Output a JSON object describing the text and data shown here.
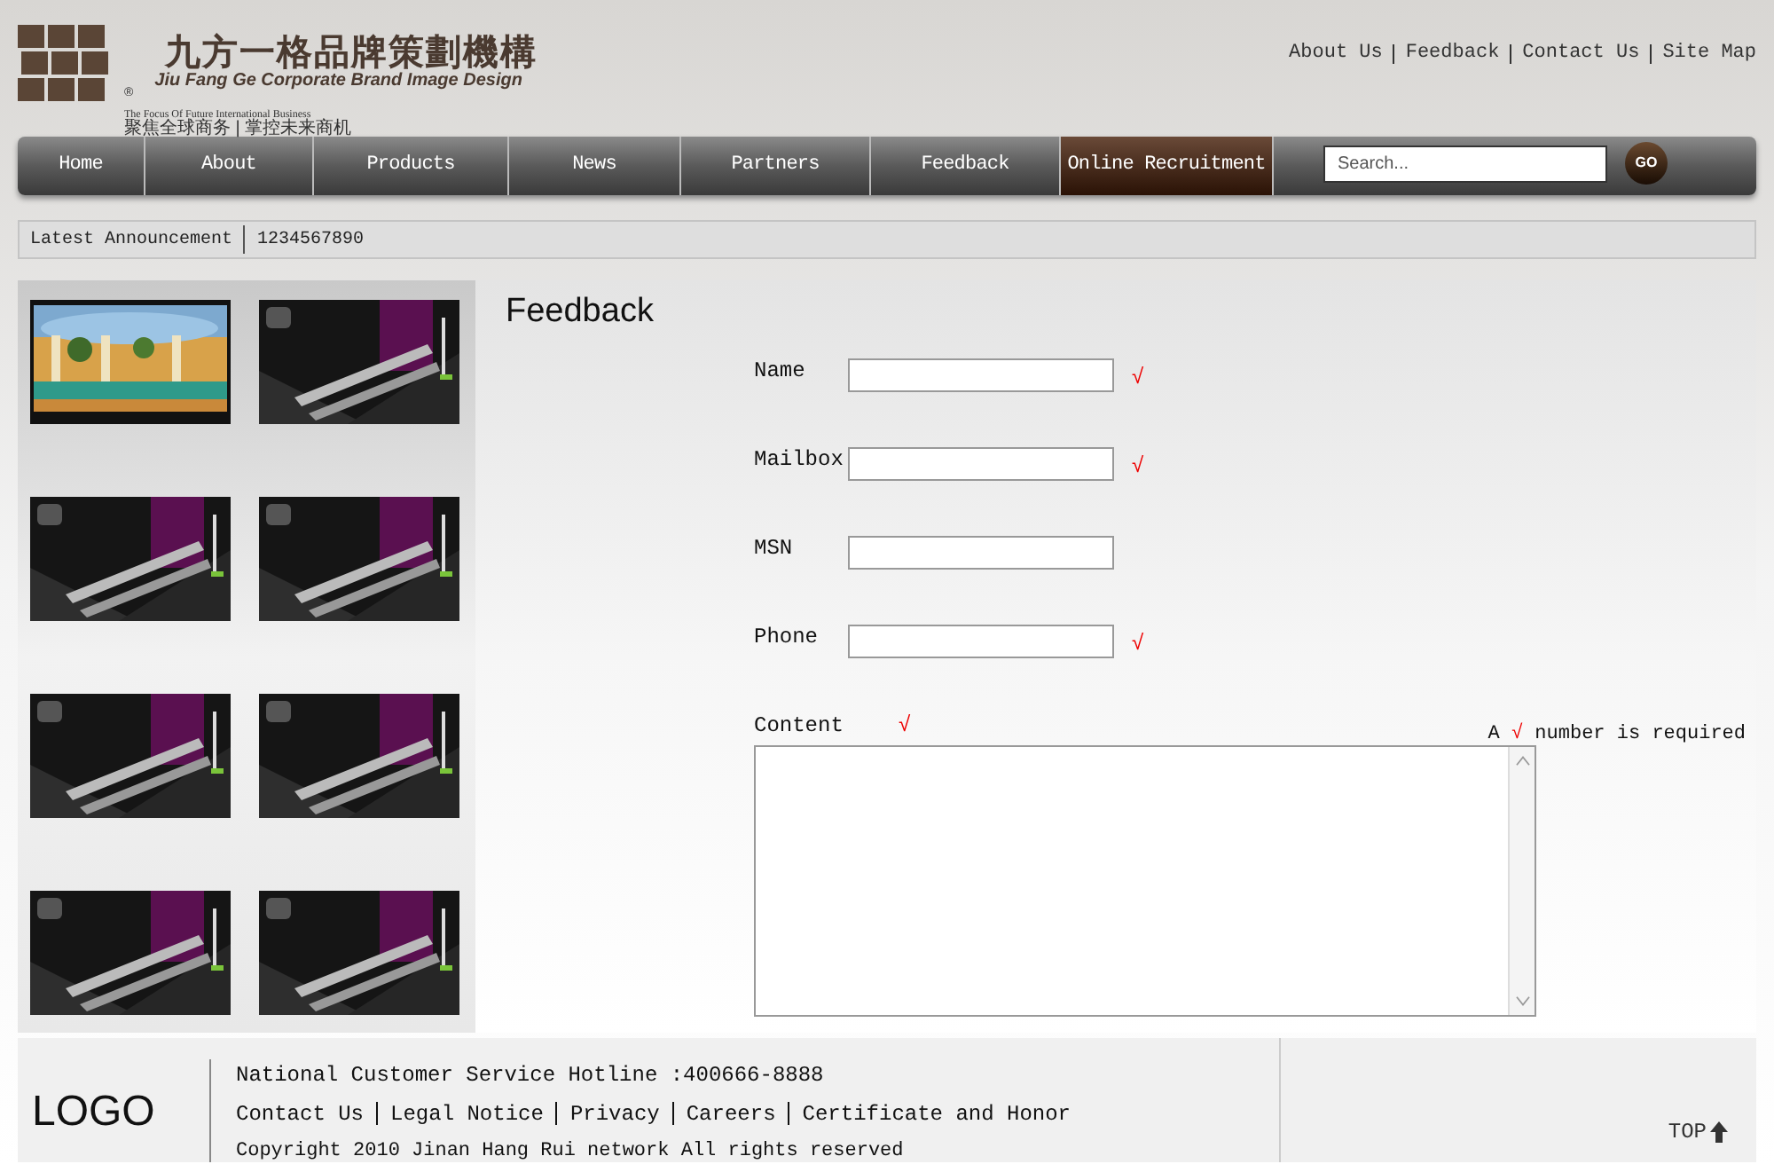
{
  "logo": {
    "title": "九方一格品牌策劃機構",
    "subtitle": "Jiu Fang Ge Corporate Brand Image Design",
    "mark": "®",
    "tagline": "The Focus Of Future International Business",
    "tagline_cn": "聚焦全球商务 | 掌控未来商机"
  },
  "top_links": [
    "About Us",
    "Feedback",
    "Contact Us",
    "Site Map"
  ],
  "nav": [
    {
      "label": "Home",
      "selected": false
    },
    {
      "label": "About",
      "selected": false
    },
    {
      "label": "Products",
      "selected": false
    },
    {
      "label": "News",
      "selected": false
    },
    {
      "label": "Partners",
      "selected": false
    },
    {
      "label": "Feedback",
      "selected": false
    },
    {
      "label": "Online Recruitment",
      "selected": true
    }
  ],
  "search": {
    "placeholder": "Search...",
    "button": "GO"
  },
  "announcement": {
    "label": "Latest Announcement",
    "text": "1234567890"
  },
  "thumbnails": [
    {
      "kind": "hall"
    },
    {
      "kind": "poster"
    },
    {
      "kind": "poster"
    },
    {
      "kind": "poster"
    },
    {
      "kind": "poster"
    },
    {
      "kind": "poster"
    },
    {
      "kind": "poster"
    },
    {
      "kind": "poster"
    }
  ],
  "form": {
    "title": "Feedback",
    "fields": [
      {
        "label": "Name",
        "required": true
      },
      {
        "label": "Mailbox",
        "required": true
      },
      {
        "label": "MSN",
        "required": false
      },
      {
        "label": "Phone",
        "required": true
      }
    ],
    "content": {
      "label": "Content",
      "required": true
    },
    "note": {
      "before": "A",
      "mark": "√",
      "after": "number is required"
    },
    "required_mark": "√"
  },
  "footer": {
    "logo": "LOGO",
    "hotline": "National Customer Service Hotline :400666-8888",
    "links": [
      "Contact Us",
      "Legal Notice",
      "Privacy",
      "Careers",
      "Certificate and Honor"
    ],
    "copyright": "Copyright 2010 Jinan Hang Rui network All rights reserved",
    "top": "TOP"
  }
}
